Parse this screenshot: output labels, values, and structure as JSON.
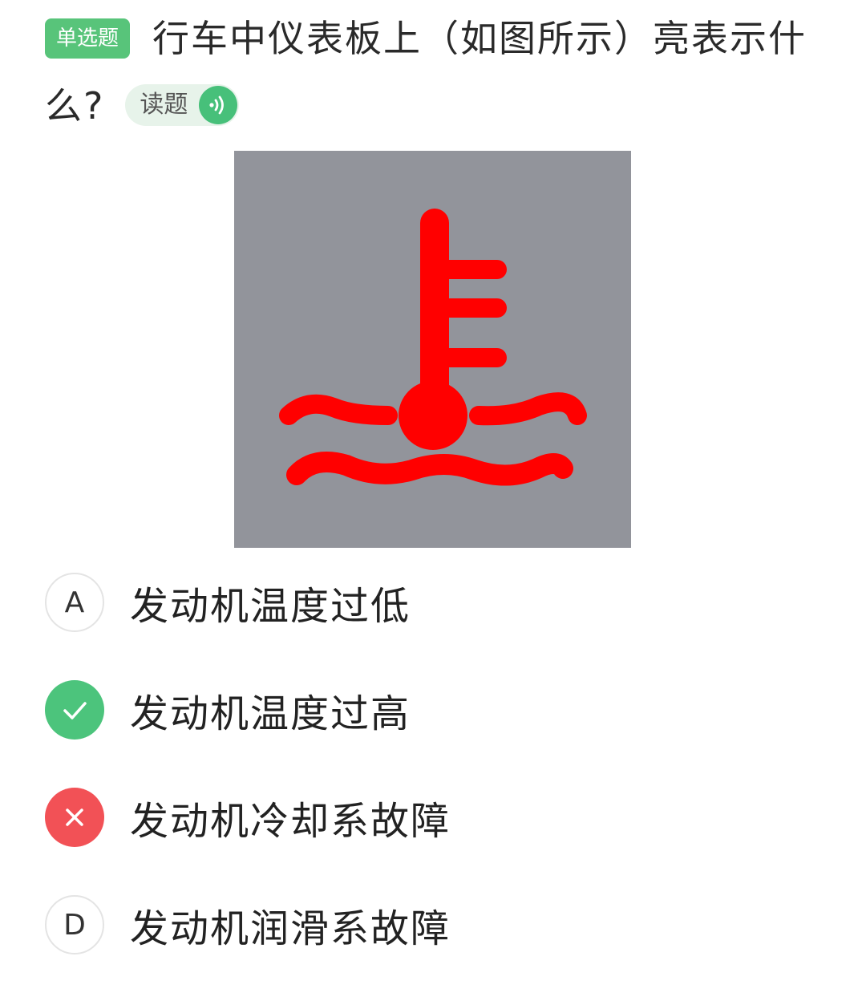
{
  "question": {
    "type_tag": "单选题",
    "text": "行车中仪表板上（如图所示）亮表示什么?",
    "read_aloud_label": "读题"
  },
  "figure": {
    "icon": "coolant-temperature-warning-icon",
    "background_color": "#92949b",
    "symbol_color": "#ff0000"
  },
  "options": [
    {
      "mark": "A",
      "text": "发动机温度过低",
      "state": "normal"
    },
    {
      "mark": "",
      "text": "发动机温度过高",
      "state": "correct"
    },
    {
      "mark": "",
      "text": "发动机冷却系故障",
      "state": "wrong"
    },
    {
      "mark": "D",
      "text": "发动机润滑系故障",
      "state": "normal"
    }
  ],
  "colors": {
    "accent_green": "#58c47a",
    "correct": "#4cc47c",
    "wrong": "#f25156"
  }
}
